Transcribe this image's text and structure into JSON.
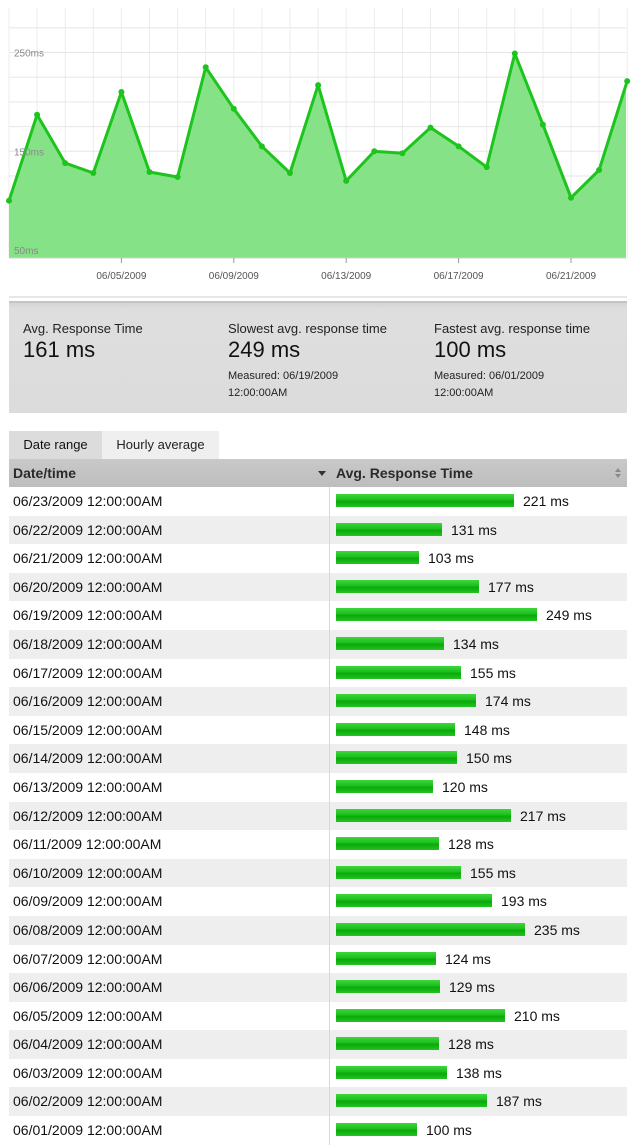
{
  "chart_data": {
    "type": "area",
    "x": [
      "06/01/2009",
      "06/02/2009",
      "06/03/2009",
      "06/04/2009",
      "06/05/2009",
      "06/06/2009",
      "06/07/2009",
      "06/08/2009",
      "06/09/2009",
      "06/10/2009",
      "06/11/2009",
      "06/12/2009",
      "06/13/2009",
      "06/14/2009",
      "06/15/2009",
      "06/16/2009",
      "06/17/2009",
      "06/18/2009",
      "06/19/2009",
      "06/20/2009",
      "06/21/2009",
      "06/22/2009",
      "06/23/2009"
    ],
    "y": [
      100,
      187,
      138,
      128,
      210,
      129,
      124,
      235,
      193,
      155,
      128,
      217,
      120,
      150,
      148,
      174,
      155,
      134,
      249,
      177,
      103,
      131,
      221
    ],
    "x_tick_labels": [
      "06/05/2009",
      "06/09/2009",
      "06/13/2009",
      "06/17/2009",
      "06/21/2009"
    ],
    "y_tick_labels": [
      "250ms",
      "150ms",
      "50ms"
    ],
    "y_ticks": [
      250,
      150,
      50
    ],
    "ylim": [
      42,
      295
    ],
    "grid": true,
    "line_color": "#1ec41e",
    "fill_color": "#7fe07f"
  },
  "summary": {
    "avg_label": "Avg. Response Time",
    "avg_value": "161 ms",
    "slowest_label": "Slowest avg. response time",
    "slowest_value": "249 ms",
    "slowest_measured": "Measured: 06/19/2009 12:00:00AM",
    "fastest_label": "Fastest avg. response time",
    "fastest_value": "100 ms",
    "fastest_measured": "Measured: 06/01/2009 12:00:00AM"
  },
  "tabs": [
    {
      "label": "Date range",
      "active": true
    },
    {
      "label": "Hourly average",
      "active": false
    }
  ],
  "table": {
    "headers": [
      "Date/time",
      "Avg. Response Time"
    ],
    "rows": [
      {
        "date": "06/23/2009 12:00:00AM",
        "value": 221,
        "label": "221 ms"
      },
      {
        "date": "06/22/2009 12:00:00AM",
        "value": 131,
        "label": "131 ms"
      },
      {
        "date": "06/21/2009 12:00:00AM",
        "value": 103,
        "label": "103 ms"
      },
      {
        "date": "06/20/2009 12:00:00AM",
        "value": 177,
        "label": "177 ms"
      },
      {
        "date": "06/19/2009 12:00:00AM",
        "value": 249,
        "label": "249 ms"
      },
      {
        "date": "06/18/2009 12:00:00AM",
        "value": 134,
        "label": "134 ms"
      },
      {
        "date": "06/17/2009 12:00:00AM",
        "value": 155,
        "label": "155 ms"
      },
      {
        "date": "06/16/2009 12:00:00AM",
        "value": 174,
        "label": "174 ms"
      },
      {
        "date": "06/15/2009 12:00:00AM",
        "value": 148,
        "label": "148 ms"
      },
      {
        "date": "06/14/2009 12:00:00AM",
        "value": 150,
        "label": "150 ms"
      },
      {
        "date": "06/13/2009 12:00:00AM",
        "value": 120,
        "label": "120 ms"
      },
      {
        "date": "06/12/2009 12:00:00AM",
        "value": 217,
        "label": "217 ms"
      },
      {
        "date": "06/11/2009 12:00:00AM",
        "value": 128,
        "label": "128 ms"
      },
      {
        "date": "06/10/2009 12:00:00AM",
        "value": 155,
        "label": "155 ms"
      },
      {
        "date": "06/09/2009 12:00:00AM",
        "value": 193,
        "label": "193 ms"
      },
      {
        "date": "06/08/2009 12:00:00AM",
        "value": 235,
        "label": "235 ms"
      },
      {
        "date": "06/07/2009 12:00:00AM",
        "value": 124,
        "label": "124 ms"
      },
      {
        "date": "06/06/2009 12:00:00AM",
        "value": 129,
        "label": "129 ms"
      },
      {
        "date": "06/05/2009 12:00:00AM",
        "value": 210,
        "label": "210 ms"
      },
      {
        "date": "06/04/2009 12:00:00AM",
        "value": 128,
        "label": "128 ms"
      },
      {
        "date": "06/03/2009 12:00:00AM",
        "value": 138,
        "label": "138 ms"
      },
      {
        "date": "06/02/2009 12:00:00AM",
        "value": 187,
        "label": "187 ms"
      },
      {
        "date": "06/01/2009 12:00:00AM",
        "value": 100,
        "label": "100 ms"
      }
    ]
  },
  "colors": {
    "bar_green": "#1cbf1c",
    "row_alt": "#eeeeee"
  }
}
